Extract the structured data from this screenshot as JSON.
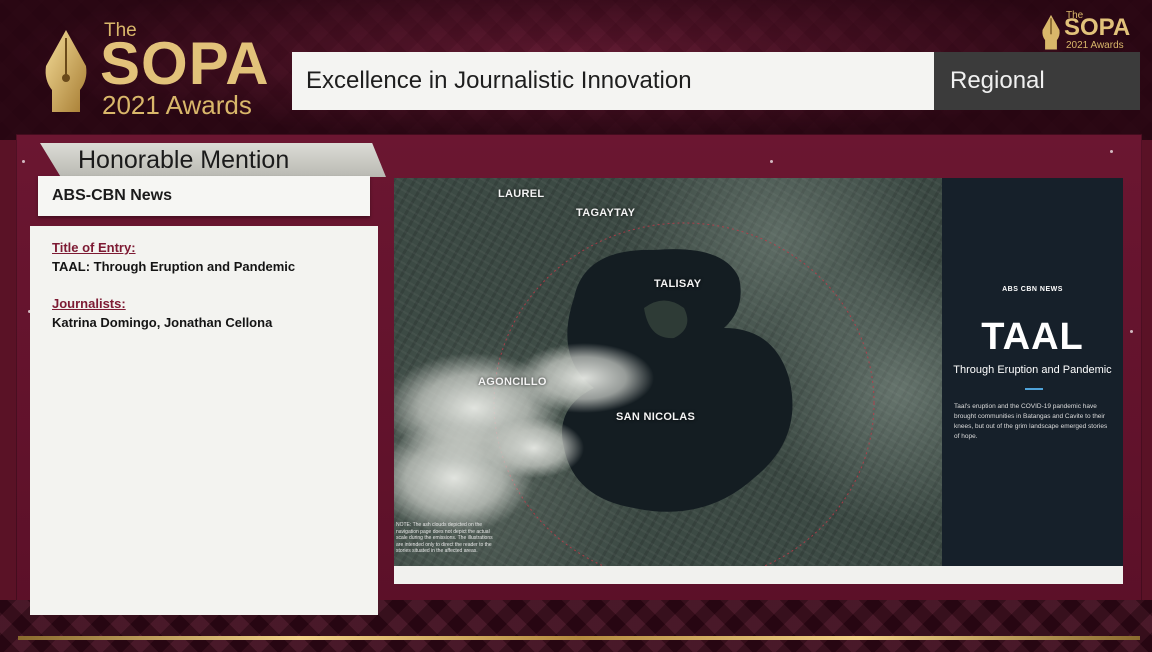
{
  "logo": {
    "the": "The",
    "sopa": "SOPA",
    "year": "2021 Awards"
  },
  "logo_small": {
    "the": "The",
    "sopa": "SOPA",
    "year": "2021 Awards"
  },
  "header": {
    "category": "Excellence in Journalistic Innovation",
    "region": "Regional"
  },
  "award": {
    "ribbon": "Honorable Mention",
    "organization": "ABS-CBN News"
  },
  "entry": {
    "title_label": "Title of Entry:",
    "title_value": "TAAL: Through Eruption and Pandemic",
    "journalists_label": "Journalists:",
    "journalists_value": "Katrina Domingo, Jonathan Cellona"
  },
  "map": {
    "labels": [
      "LAUREL",
      "TAGAYTAY",
      "TALISAY",
      "AGONCILLO",
      "SAN NICOLAS"
    ],
    "note": "NOTE: The ash clouds depicted on the navigation page does not depict the actual scale during the emissions. The illustrations are intended only to direct the reader to the stories situated in the affected areas."
  },
  "feature": {
    "brand": "ABS CBN NEWS",
    "title": "TAAL",
    "subtitle": "Through Eruption and Pandemic",
    "description": "Taal's eruption and the COVID-19 pandemic have brought communities in Batangas and Cavite to their knees, but out of the grim landscape emerged stories of hope."
  },
  "colors": {
    "maroon": "#6b1631",
    "gold": "#e2c27a",
    "dark_panel": "#16202a"
  }
}
